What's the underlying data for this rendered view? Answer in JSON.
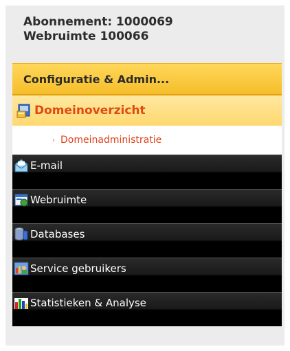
{
  "account": {
    "subscription": "Abonnement: 1000069",
    "webspace": "Webruimte 100066"
  },
  "menu": {
    "section_title": "Configuratie & Admin...",
    "active_item": {
      "label": "Domeinoverzicht",
      "icon": "domain-overview-icon"
    },
    "sub_items": [
      {
        "label": "Domeinadministratie"
      }
    ],
    "items": [
      {
        "label": "E-mail",
        "icon": "email-icon"
      },
      {
        "label": "Webruimte",
        "icon": "webspace-icon"
      },
      {
        "label": "Databases",
        "icon": "database-icon"
      },
      {
        "label": "Service gebruikers",
        "icon": "service-users-icon"
      },
      {
        "label": "Statistieken & Analyse",
        "icon": "statistics-icon"
      }
    ]
  },
  "colors": {
    "accent": "#e04a10",
    "header_bg": "#ffd75a",
    "dark_item_bg": "#1a1a1a"
  }
}
